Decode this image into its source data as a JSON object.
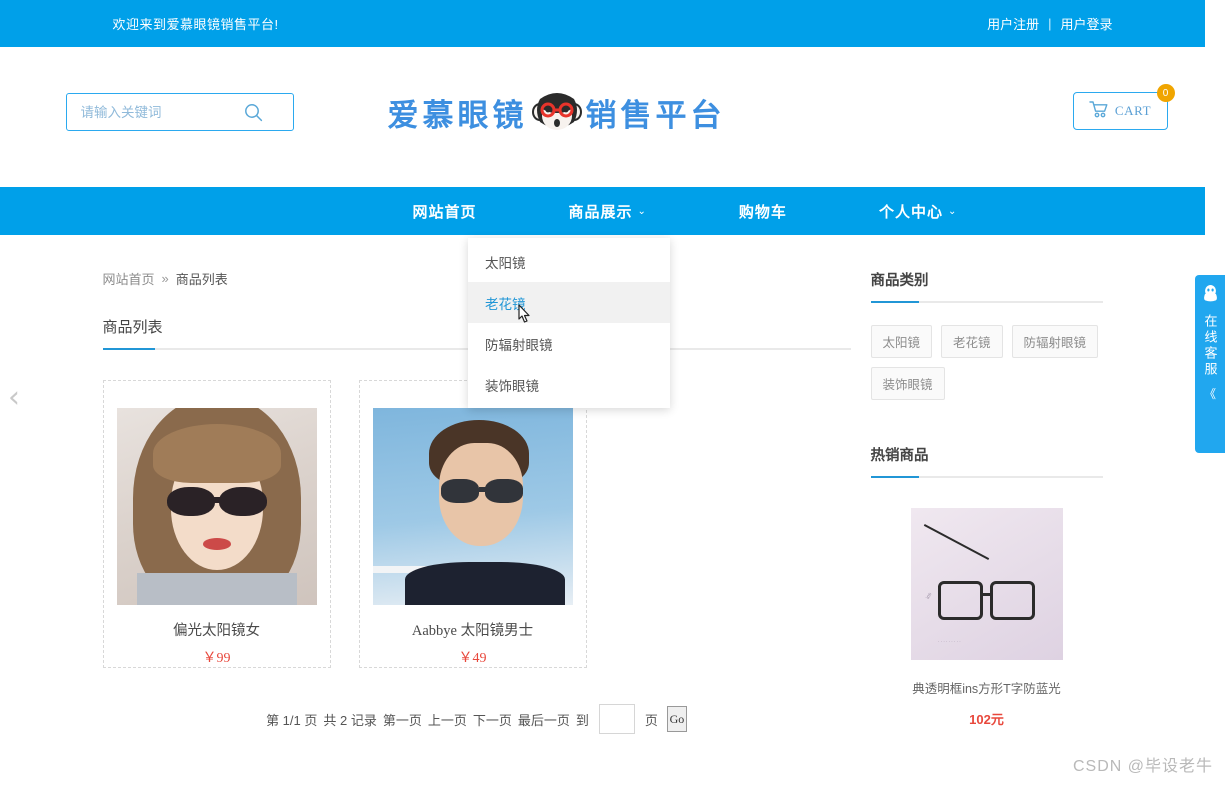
{
  "colors": {
    "brand_blue": "#00a0e9",
    "accent_blue": "#2196d6",
    "price_red": "#e8483c",
    "badge_orange": "#f0a500"
  },
  "topbar": {
    "welcome": "欢迎来到爱慕眼镜销售平台!",
    "register": "用户注册",
    "separator": "|",
    "login": "用户登录"
  },
  "header": {
    "search": {
      "placeholder": "请输入关键词",
      "value": "",
      "icon": "search-icon"
    },
    "logo": {
      "left_text": "爱慕眼镜",
      "right_text": "销售平台",
      "mascot": "monkey-with-red-glasses-icon"
    },
    "cart": {
      "label": "CART",
      "icon": "shopping-cart-icon",
      "count": "0"
    }
  },
  "nav": {
    "items": [
      {
        "label": "网站首页",
        "has_caret": false
      },
      {
        "label": "商品展示",
        "has_caret": true
      },
      {
        "label": "购物车",
        "has_caret": false
      },
      {
        "label": "个人中心",
        "has_caret": true
      }
    ],
    "caret": "⌄"
  },
  "dropdown": {
    "open_for": "商品展示",
    "items": [
      {
        "label": "太阳镜",
        "active": false
      },
      {
        "label": "老花镜",
        "active": true
      },
      {
        "label": "防辐射眼镜",
        "active": false
      },
      {
        "label": "装饰眼镜",
        "active": false
      }
    ]
  },
  "breadcrumb": {
    "home": "网站首页",
    "separator": "»",
    "current": "商品列表"
  },
  "main": {
    "section_title": "商品列表",
    "products": [
      {
        "name": "偏光太阳镜女",
        "price": "￥99",
        "thumb": "woman-sunglasses-photo"
      },
      {
        "name": "Aabbye 太阳镜男士",
        "price": "￥49",
        "thumb": "man-sunglasses-photo"
      }
    ],
    "pager": {
      "page_info": "第 1/1 页",
      "record_info": "共 2 记录",
      "first": "第一页",
      "prev": "上一页",
      "next": "下一页",
      "last": "最后一页",
      "goto_prefix": "到",
      "goto_value": "",
      "goto_suffix": "页",
      "go_button": "Go"
    }
  },
  "sidebar": {
    "category": {
      "title": "商品类别",
      "tags": [
        "太阳镜",
        "老花镜",
        "防辐射眼镜",
        "装饰眼镜"
      ]
    },
    "hot": {
      "title": "热销商品",
      "items": [
        {
          "name": "典透明框ins方形T字防蓝光",
          "price": "102元",
          "thumb": "blue-light-glasses-photo"
        }
      ]
    }
  },
  "service_widget": {
    "icon": "qq-penguin-icon",
    "text": "在线客服",
    "collapse": "《"
  },
  "carousel": {
    "prev_icon": "chevron-left-icon"
  },
  "watermark": {
    "text": "CSDN @毕设老牛"
  }
}
